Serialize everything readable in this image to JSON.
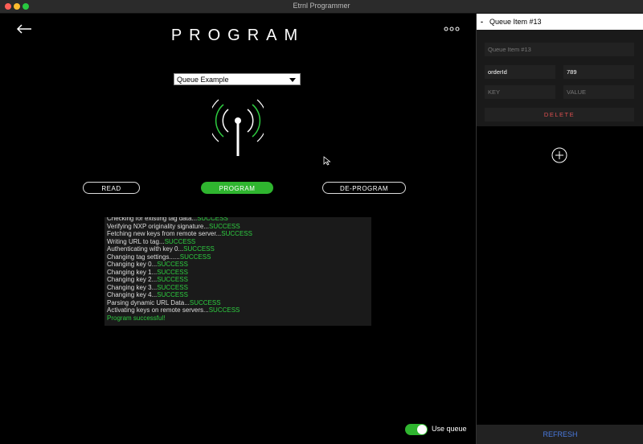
{
  "window": {
    "title": "Etrnl Programmer"
  },
  "main": {
    "title": "PROGRAM",
    "select": {
      "value": "Queue Example"
    },
    "buttons": {
      "read": "READ",
      "program": "PROGRAM",
      "deprogram": "DE-PROGRAM"
    },
    "log": [
      {
        "text": "Checking for existing tag data...",
        "status": "SUCCESS"
      },
      {
        "text": "Verifying NXP originality signature...",
        "status": "SUCCESS"
      },
      {
        "text": "Fetching new keys from remote server...",
        "status": "SUCCESS"
      },
      {
        "text": "Writing URL to tag...",
        "status": "SUCCESS"
      },
      {
        "text": "Authenticating with key 0...",
        "status": "SUCCESS"
      },
      {
        "text": "Changing tag settings......",
        "status": "SUCCESS"
      },
      {
        "text": "Changing key 0...",
        "status": "SUCCESS"
      },
      {
        "text": "Changing key 1...",
        "status": "SUCCESS"
      },
      {
        "text": "Changing key 2...",
        "status": "SUCCESS"
      },
      {
        "text": "Changing key 3...",
        "status": "SUCCESS"
      },
      {
        "text": "Changing key 4...",
        "status": "SUCCESS"
      },
      {
        "text": "Parsing dynamic URL Data...",
        "status": "SUCCESS"
      },
      {
        "text": "Activating keys on remote servers...",
        "status": "SUCCESS"
      },
      {
        "text": "Program successful!",
        "status": ""
      }
    ],
    "use_queue": {
      "label": "Use queue",
      "enabled": true
    }
  },
  "panel": {
    "collapse_symbol": "-",
    "title": "Queue Item #13",
    "name_placeholder": "Queue Item #13",
    "entry": {
      "key": "orderId",
      "value": "789"
    },
    "key_placeholder": "KEY",
    "value_placeholder": "VALUE",
    "delete_label": "DELETE",
    "refresh_label": "REFRESH"
  },
  "colors": {
    "accent": "#2fb52f",
    "success": "#2ecc40",
    "danger": "#e05050",
    "link": "#4a7adf"
  },
  "icons": {
    "back": "back-arrow-icon",
    "more": "more-icon",
    "antenna": "antenna-icon",
    "add": "add-icon",
    "cursor": "cursor-icon"
  }
}
